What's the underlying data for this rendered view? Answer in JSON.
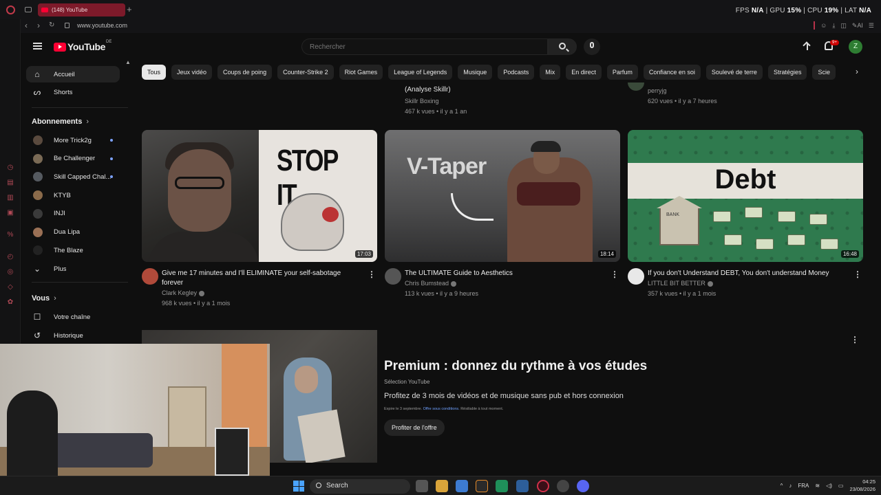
{
  "browser": {
    "tab_title": "(148) YouTube",
    "url": "www.youtube.com",
    "perf": {
      "fps_label": "FPS",
      "fps": "N/A",
      "gpu_label": "GPU",
      "gpu": "15%",
      "cpu_label": "CPU",
      "cpu": "19%",
      "lat_label": "LAT",
      "lat": "N/A"
    },
    "ai_label": "AI"
  },
  "header": {
    "logo_text": "YouTube",
    "country_code": "DE",
    "search_placeholder": "Rechercher",
    "notif_count": "9+",
    "avatar_letter": "Z"
  },
  "sidebar": {
    "home": "Accueil",
    "shorts": "Shorts",
    "subs_heading": "Abonnements",
    "subscriptions": [
      {
        "name": "More Trick2g",
        "color": "#5a4a3e",
        "new": true
      },
      {
        "name": "Be Challenger",
        "color": "#7a6a55",
        "new": true
      },
      {
        "name": "Skill Capped Chal...",
        "color": "#555a60",
        "new": true
      },
      {
        "name": "KTYB",
        "color": "#8a6a4a",
        "new": false
      },
      {
        "name": "INJI",
        "color": "#3a3a3a",
        "new": false
      },
      {
        "name": "Dua Lipa",
        "color": "#9a7055",
        "new": false
      },
      {
        "name": "The Blaze",
        "color": "#222222",
        "new": false
      }
    ],
    "more": "Plus",
    "you_heading": "Vous",
    "your_channel": "Votre chaîne",
    "history": "Historique"
  },
  "chips": [
    "Tous",
    "Jeux vidéo",
    "Coups de poing",
    "Counter-Strike 2",
    "Riot Games",
    "League of Legends",
    "Musique",
    "Podcasts",
    "Mix",
    "En direct",
    "Parfum",
    "Confiance en soi",
    "Soulevé de terre",
    "Stratégies",
    "Scie"
  ],
  "top_row": {
    "v1_title": "(Analyse Skillr)",
    "v1_channel": "Skillr Boxing",
    "v1_meta": "467 k vues • il y a 1 an",
    "v2_channel": "perryjg",
    "v2_meta": "620 vues • il y a 7 heures"
  },
  "videos": [
    {
      "title": "Give me 17 minutes and I'll ELIMINATE your self-sabotage forever",
      "channel": "Clark Kegley",
      "meta": "968 k vues • il y a 1 mois",
      "duration": "17:03",
      "thumb_text": "STOP IT",
      "avatar_color": "#b04a3a"
    },
    {
      "title": "The ULTIMATE Guide to Aesthetics",
      "channel": "Chris Bumstead",
      "meta": "113 k vues • il y a 9 heures",
      "duration": "18:14",
      "thumb_text": "V-Taper",
      "avatar_color": "#555555"
    },
    {
      "title": "If you don't Understand DEBT, You don't understand Money",
      "channel": "LITTLE BIT BETTER",
      "meta": "357 k vues • il y a 1 mois",
      "duration": "16:48",
      "thumb_text": "Debt",
      "avatar_color": "#e8e8e8",
      "bank_label": "BANK"
    }
  ],
  "promo": {
    "title": "Premium : donnez du rythme à vos études",
    "source": "Sélection YouTube",
    "description": "Profitez de 3 mois de vidéos et de musique sans pub et hors connexion",
    "legal_prefix": "Expire le 3 septembre.",
    "legal_link": "Offre sous conditions.",
    "legal_suffix": "Résiliable à tout moment.",
    "cta": "Profiter de l'offre"
  },
  "taskbar": {
    "search_label": "Search",
    "lang": "FRA",
    "time": "04:25",
    "date": "23/08/2026"
  }
}
